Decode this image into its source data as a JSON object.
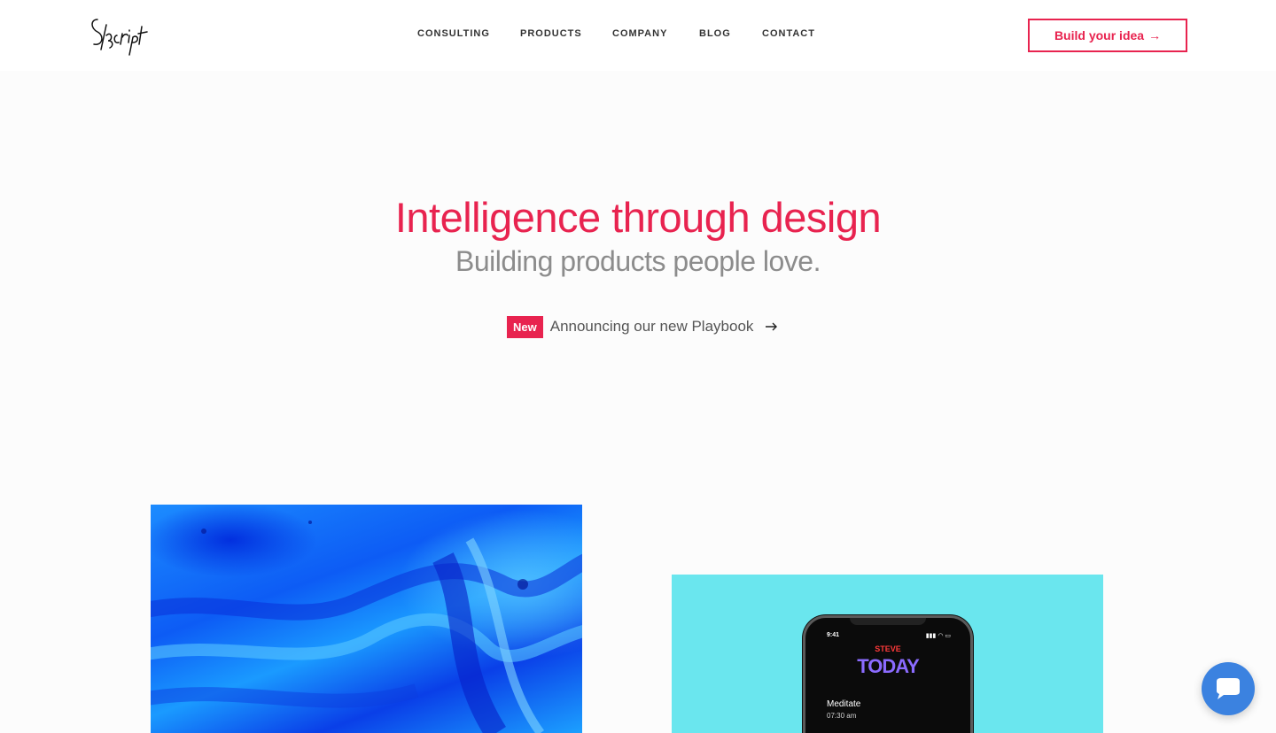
{
  "header": {
    "logo_text": "Skcript",
    "nav": [
      {
        "label": "CONSULTING"
      },
      {
        "label": "PRODUCTS"
      },
      {
        "label": "COMPANY"
      },
      {
        "label": "BLOG"
      },
      {
        "label": "CONTACT"
      }
    ],
    "cta_label": "Build your idea",
    "cta_arrow": "→"
  },
  "hero": {
    "title": "Intelligence through design",
    "subtitle": "Building products people love.",
    "badge": "New",
    "announcement": "Announcing our new Playbook"
  },
  "phone": {
    "time": "9:41",
    "status": "▮▮▮ ◠ ▭",
    "brand": "STEVE",
    "screen_title": "TODAY",
    "task": "Meditate",
    "task_time": "07:30 am"
  },
  "colors": {
    "accent": "#e8234f",
    "chat": "#3b82e0",
    "tile_right_bg": "#6ae6ee"
  },
  "icons": {
    "announce_arrow": "arrow-right-icon",
    "chat": "chat-icon"
  }
}
